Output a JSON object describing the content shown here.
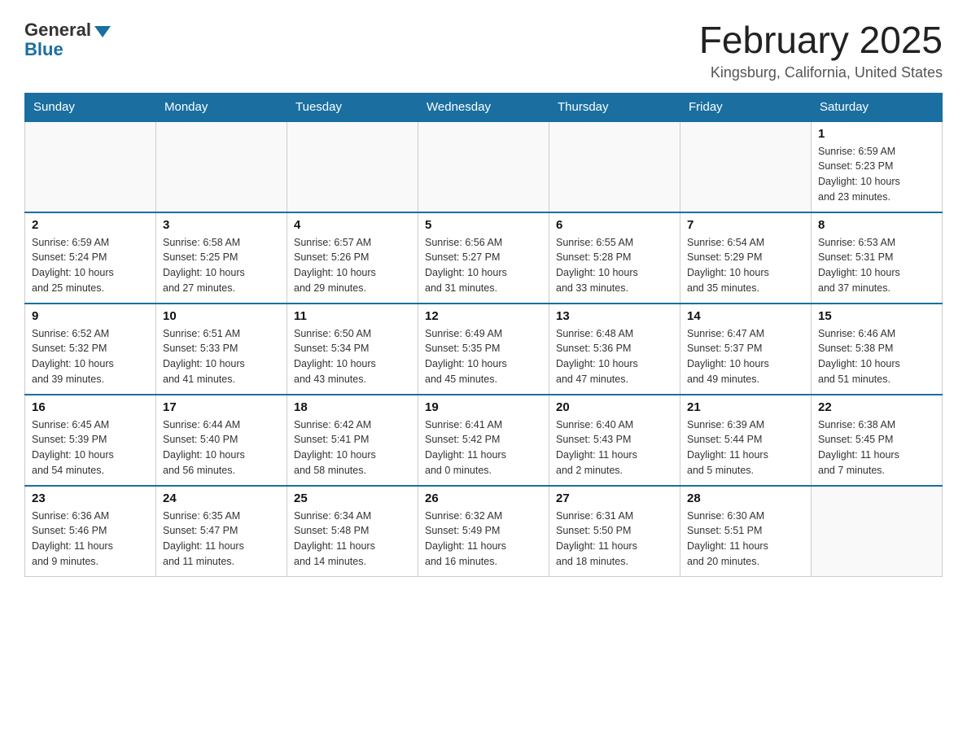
{
  "header": {
    "logo_general": "General",
    "logo_blue": "Blue",
    "title": "February 2025",
    "subtitle": "Kingsburg, California, United States"
  },
  "days": [
    "Sunday",
    "Monday",
    "Tuesday",
    "Wednesday",
    "Thursday",
    "Friday",
    "Saturday"
  ],
  "weeks": [
    [
      {
        "date": "",
        "info": ""
      },
      {
        "date": "",
        "info": ""
      },
      {
        "date": "",
        "info": ""
      },
      {
        "date": "",
        "info": ""
      },
      {
        "date": "",
        "info": ""
      },
      {
        "date": "",
        "info": ""
      },
      {
        "date": "1",
        "info": "Sunrise: 6:59 AM\nSunset: 5:23 PM\nDaylight: 10 hours\nand 23 minutes."
      }
    ],
    [
      {
        "date": "2",
        "info": "Sunrise: 6:59 AM\nSunset: 5:24 PM\nDaylight: 10 hours\nand 25 minutes."
      },
      {
        "date": "3",
        "info": "Sunrise: 6:58 AM\nSunset: 5:25 PM\nDaylight: 10 hours\nand 27 minutes."
      },
      {
        "date": "4",
        "info": "Sunrise: 6:57 AM\nSunset: 5:26 PM\nDaylight: 10 hours\nand 29 minutes."
      },
      {
        "date": "5",
        "info": "Sunrise: 6:56 AM\nSunset: 5:27 PM\nDaylight: 10 hours\nand 31 minutes."
      },
      {
        "date": "6",
        "info": "Sunrise: 6:55 AM\nSunset: 5:28 PM\nDaylight: 10 hours\nand 33 minutes."
      },
      {
        "date": "7",
        "info": "Sunrise: 6:54 AM\nSunset: 5:29 PM\nDaylight: 10 hours\nand 35 minutes."
      },
      {
        "date": "8",
        "info": "Sunrise: 6:53 AM\nSunset: 5:31 PM\nDaylight: 10 hours\nand 37 minutes."
      }
    ],
    [
      {
        "date": "9",
        "info": "Sunrise: 6:52 AM\nSunset: 5:32 PM\nDaylight: 10 hours\nand 39 minutes."
      },
      {
        "date": "10",
        "info": "Sunrise: 6:51 AM\nSunset: 5:33 PM\nDaylight: 10 hours\nand 41 minutes."
      },
      {
        "date": "11",
        "info": "Sunrise: 6:50 AM\nSunset: 5:34 PM\nDaylight: 10 hours\nand 43 minutes."
      },
      {
        "date": "12",
        "info": "Sunrise: 6:49 AM\nSunset: 5:35 PM\nDaylight: 10 hours\nand 45 minutes."
      },
      {
        "date": "13",
        "info": "Sunrise: 6:48 AM\nSunset: 5:36 PM\nDaylight: 10 hours\nand 47 minutes."
      },
      {
        "date": "14",
        "info": "Sunrise: 6:47 AM\nSunset: 5:37 PM\nDaylight: 10 hours\nand 49 minutes."
      },
      {
        "date": "15",
        "info": "Sunrise: 6:46 AM\nSunset: 5:38 PM\nDaylight: 10 hours\nand 51 minutes."
      }
    ],
    [
      {
        "date": "16",
        "info": "Sunrise: 6:45 AM\nSunset: 5:39 PM\nDaylight: 10 hours\nand 54 minutes."
      },
      {
        "date": "17",
        "info": "Sunrise: 6:44 AM\nSunset: 5:40 PM\nDaylight: 10 hours\nand 56 minutes."
      },
      {
        "date": "18",
        "info": "Sunrise: 6:42 AM\nSunset: 5:41 PM\nDaylight: 10 hours\nand 58 minutes."
      },
      {
        "date": "19",
        "info": "Sunrise: 6:41 AM\nSunset: 5:42 PM\nDaylight: 11 hours\nand 0 minutes."
      },
      {
        "date": "20",
        "info": "Sunrise: 6:40 AM\nSunset: 5:43 PM\nDaylight: 11 hours\nand 2 minutes."
      },
      {
        "date": "21",
        "info": "Sunrise: 6:39 AM\nSunset: 5:44 PM\nDaylight: 11 hours\nand 5 minutes."
      },
      {
        "date": "22",
        "info": "Sunrise: 6:38 AM\nSunset: 5:45 PM\nDaylight: 11 hours\nand 7 minutes."
      }
    ],
    [
      {
        "date": "23",
        "info": "Sunrise: 6:36 AM\nSunset: 5:46 PM\nDaylight: 11 hours\nand 9 minutes."
      },
      {
        "date": "24",
        "info": "Sunrise: 6:35 AM\nSunset: 5:47 PM\nDaylight: 11 hours\nand 11 minutes."
      },
      {
        "date": "25",
        "info": "Sunrise: 6:34 AM\nSunset: 5:48 PM\nDaylight: 11 hours\nand 14 minutes."
      },
      {
        "date": "26",
        "info": "Sunrise: 6:32 AM\nSunset: 5:49 PM\nDaylight: 11 hours\nand 16 minutes."
      },
      {
        "date": "27",
        "info": "Sunrise: 6:31 AM\nSunset: 5:50 PM\nDaylight: 11 hours\nand 18 minutes."
      },
      {
        "date": "28",
        "info": "Sunrise: 6:30 AM\nSunset: 5:51 PM\nDaylight: 11 hours\nand 20 minutes."
      },
      {
        "date": "",
        "info": ""
      }
    ]
  ]
}
